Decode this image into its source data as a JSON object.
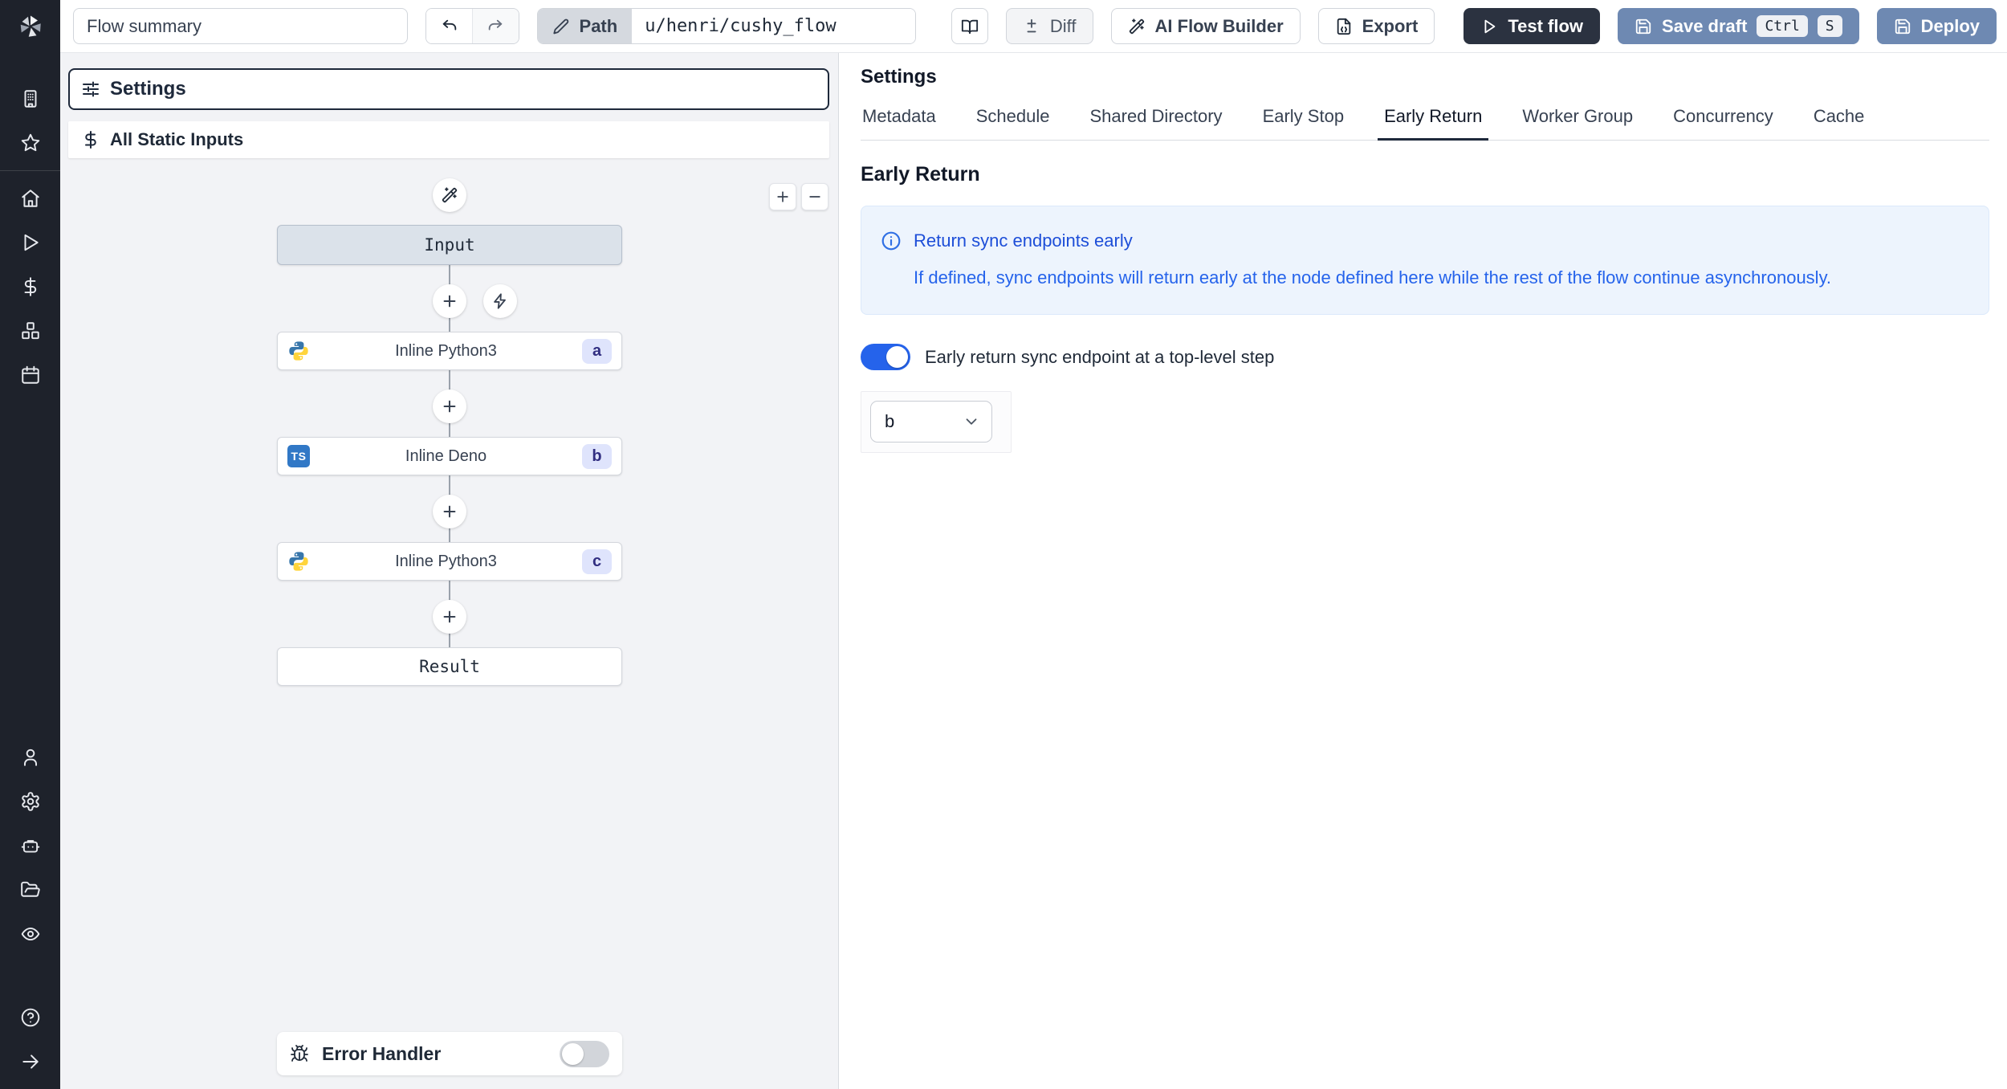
{
  "topbar": {
    "flow_summary": "Flow summary",
    "path_label": "Path",
    "path_value": "u/henri/cushy_flow",
    "diff_label": "Diff",
    "ai_flow_builder_label": "AI Flow Builder",
    "export_label": "Export",
    "test_flow_label": "Test flow",
    "save_draft_label": "Save draft",
    "save_draft_kbd": [
      "Ctrl",
      "S"
    ],
    "deploy_label": "Deploy"
  },
  "left_panel": {
    "settings_label": "Settings",
    "all_static_inputs_label": "All Static Inputs"
  },
  "flow": {
    "nodes": [
      {
        "label": "Input"
      },
      {
        "label": "Inline Python3",
        "badge": "a",
        "lang": "python"
      },
      {
        "label": "Inline Deno",
        "badge": "b",
        "lang": "typescript",
        "icon_text": "TS"
      },
      {
        "label": "Inline Python3",
        "badge": "c",
        "lang": "python"
      },
      {
        "label": "Result"
      }
    ],
    "error_handler_label": "Error Handler",
    "error_handler_enabled": false
  },
  "settings_panel": {
    "title": "Settings",
    "tabs": [
      "Metadata",
      "Schedule",
      "Shared Directory",
      "Early Stop",
      "Early Return",
      "Worker Group",
      "Concurrency",
      "Cache"
    ],
    "active_tab": "Early Return",
    "section_title": "Early Return",
    "info": {
      "title": "Return sync endpoints early",
      "body": "If defined, sync endpoints will return early at the node defined here while the rest of the flow continue asynchronously."
    },
    "toggle_label": "Early return sync endpoint at a top-level step",
    "toggle_on": true,
    "step_select_value": "b"
  },
  "colors": {
    "accent_blue": "#2563eb",
    "steel_button": "#6e89b2",
    "dark_button": "#2b3240",
    "sidebar": "#1e222b",
    "badge_bg": "#dfe4fc",
    "badge_text": "#312e81"
  }
}
